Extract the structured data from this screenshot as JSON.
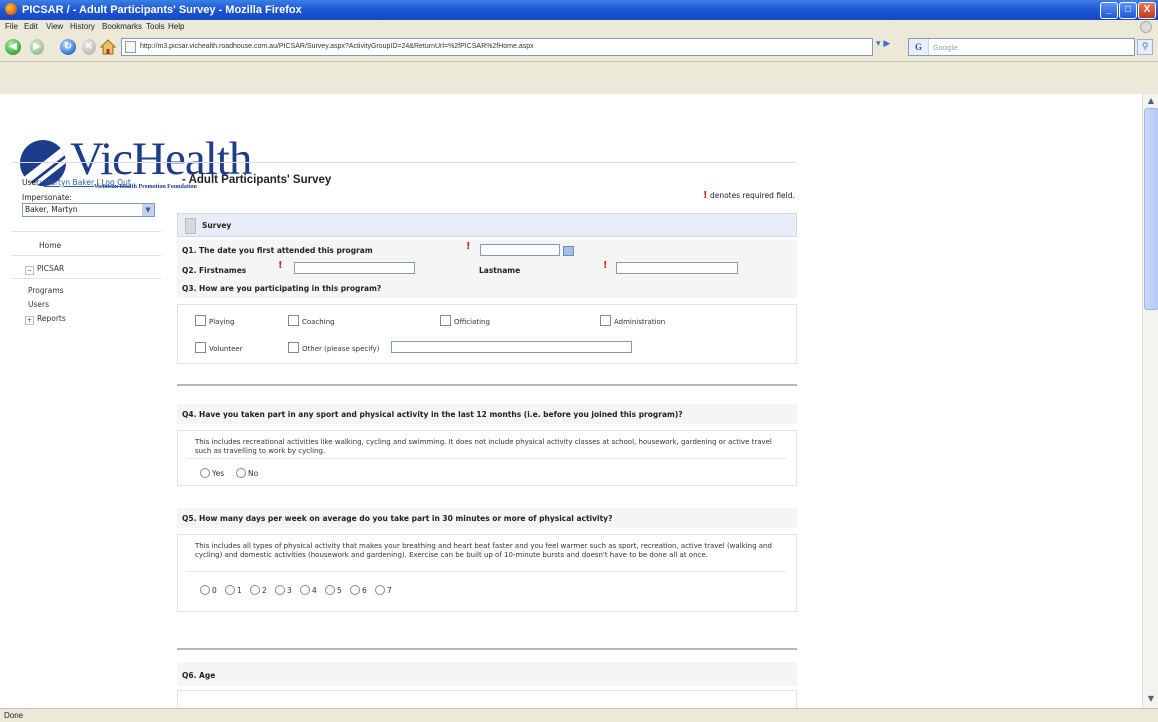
{
  "window": {
    "title": "PICSAR / - Adult Participants' Survey - Mozilla Firefox",
    "minimize": "_",
    "maximize": "□",
    "close": "X"
  },
  "menu": [
    "File",
    "Edit",
    "View",
    "History",
    "Bookmarks",
    "Tools",
    "Help"
  ],
  "nav": {
    "url": "http://m3.picsar.vichealth.roadhouse.com.au/PICSAR/Survey.aspx?ActivityGroupID=24&ReturnUrl=%2fPICSAR%2fHome.aspx",
    "search_engine": "G",
    "search_placeholder": "Google"
  },
  "status": "Done",
  "logo": {
    "name": "VicHealth",
    "tagline": "Victorian Health Promotion Foundation"
  },
  "sidebar": {
    "user_label": "User:",
    "user_name": "Martyn Baker",
    "separator": "|",
    "logout": "Log Out",
    "impersonate_label": "Impersonate:",
    "impersonate_value": "Baker, Martyn",
    "items": [
      {
        "label": "Home"
      },
      {
        "label": "PICSAR"
      },
      {
        "label": "Programs"
      },
      {
        "label": "Users"
      },
      {
        "label": "Reports"
      }
    ]
  },
  "page": {
    "title": "- Adult Participants' Survey",
    "required_note": "denotes required field.",
    "required_mark": "!",
    "section": "Survey"
  },
  "questions": {
    "q1": "Q1. The date you first attended this program",
    "q2": "Q2. Firstnames",
    "q2_last": "Lastname",
    "q3": "Q3. How are you participating in this program?",
    "q3_options": [
      "Playing",
      "Coaching",
      "Officiating",
      "Administration",
      "Volunteer",
      "Other (please specify)"
    ],
    "q4": "Q4. Have you taken part in any sport and physical activity in the last 12 months (i.e. before you joined this program)?",
    "q4_note": "This includes recreational activities like walking, cycling and swimming. It does not include physical activity classes at school, housework, gardening or active travel such as travelling to work by cycling.",
    "q4_options": [
      "Yes",
      "No"
    ],
    "q5": "Q5. How many days per week on average do you take part in 30 minutes or more of physical activity?",
    "q5_note": "This includes all types of physical activity that makes your breathing and heart beat faster and you feel warmer such as sport, recreation, active travel (walking and cycling) and domestic activities (housework and gardening). Exercise can be built up of 10-minute bursts and doesn't have to be done all at once.",
    "q5_options": [
      "0",
      "1",
      "2",
      "3",
      "4",
      "5",
      "6",
      "7"
    ],
    "q6": "Q6. Age"
  }
}
